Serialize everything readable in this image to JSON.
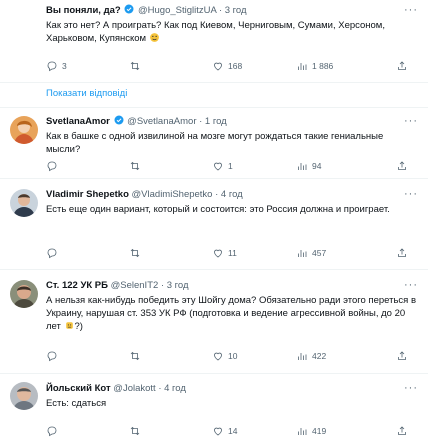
{
  "tweets": [
    {
      "name": "Вы поняли, да?",
      "handle": "@Hugo_StiglitzUA",
      "time": "· 3 год",
      "text": "Как это нет? А проиграть? Как под Киевом, Черниговым, Сумами, Херсоном, Харьковом, Купянском",
      "counts": {
        "reply": "3",
        "repost": "",
        "like": "168",
        "views": "1 886"
      },
      "verified": true
    },
    {
      "name": "SvetlanaAmor",
      "handle": "@SvetlanaAmor",
      "time": "· 1 год",
      "text": "Как в башке с одной извилиной на мозге могут рождаться такие гениальные мысли?",
      "counts": {
        "reply": "",
        "repost": "",
        "like": "1",
        "views": "94"
      },
      "verified": true
    },
    {
      "name": "Vladimir Shepetko",
      "handle": "@VladimiShepetko",
      "time": "· 4 год",
      "text": "Есть еще один вариант, который и состоится: это Россия должна и проиграет.",
      "counts": {
        "reply": "",
        "repost": "",
        "like": "11",
        "views": "457"
      },
      "verified": false
    },
    {
      "name": "Ст. 122 УК РБ",
      "handle": "@SelenIT2",
      "time": "· 3 год",
      "text": "А нельзя как-нибудь победить эту Шойгу дома? Обязательно ради этого переться в Украину, нарушая ст. 353 УК РФ (подготовка и ведение агрессивной войны, до 20 лет",
      "text_end": "?)",
      "counts": {
        "reply": "",
        "repost": "",
        "like": "10",
        "views": "422"
      },
      "verified": false
    },
    {
      "name": "Йольский Кот",
      "handle": "@Jolakott",
      "time": "· 4 год",
      "text": "Есть: сдаться",
      "counts": {
        "reply": "",
        "repost": "",
        "like": "14",
        "views": "419"
      },
      "verified": false
    }
  ],
  "show_replies": "Показати відповіді",
  "more_label": "···",
  "colors": {
    "accent": "#1d9bf0",
    "muted": "#536471",
    "border": "#eff3f4"
  }
}
